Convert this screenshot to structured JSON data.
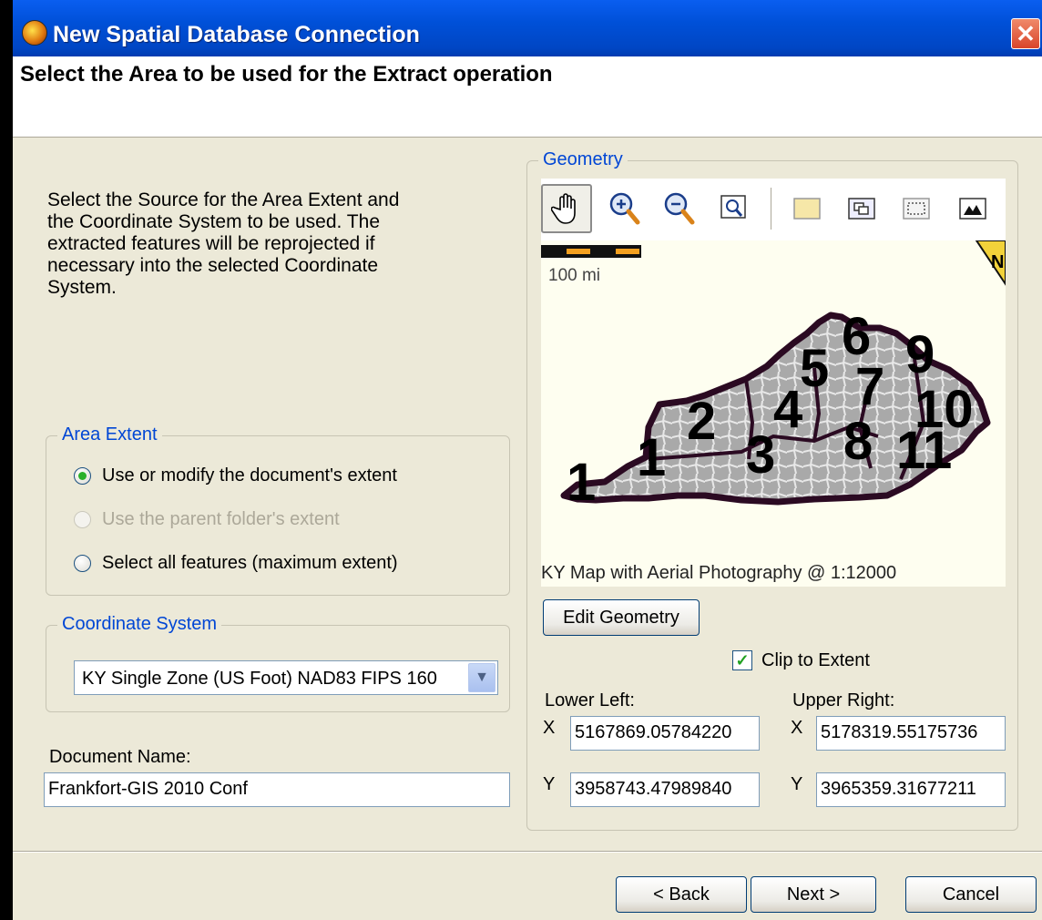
{
  "window": {
    "title": "New Spatial Database Connection",
    "close_glyph": "✕"
  },
  "header": {
    "title": "Select the Area to be used for the Extract operation"
  },
  "instructions": "Select the Source for the Area Extent and the Coordinate System to be used. The extracted features will be reprojected if necessary into the selected Coordinate System.",
  "area_extent": {
    "legend": "Area Extent",
    "options": [
      {
        "label": "Use or modify the document's extent",
        "checked": true,
        "enabled": true
      },
      {
        "label": "Use the parent folder's extent",
        "checked": false,
        "enabled": false
      },
      {
        "label": "Select all features (maximum extent)",
        "checked": false,
        "enabled": true
      }
    ]
  },
  "coordinate_system": {
    "legend": "Coordinate System",
    "selected": "KY Single Zone (US Foot) NAD83 FIPS 160"
  },
  "document_name": {
    "label": "Document Name:",
    "value": "Frankfort-GIS 2010 Conf"
  },
  "geometry": {
    "legend": "Geometry",
    "tools": [
      {
        "icon": "pan-hand-icon",
        "active": true
      },
      {
        "icon": "zoom-in-icon",
        "active": false
      },
      {
        "icon": "zoom-out-icon",
        "active": false
      },
      {
        "icon": "zoom-window-icon",
        "active": false
      },
      {
        "icon": "folder-extent-icon",
        "active": false
      },
      {
        "icon": "full-extent-icon",
        "active": false
      },
      {
        "icon": "select-rectangle-icon",
        "active": false
      },
      {
        "icon": "map-view-icon",
        "active": false
      }
    ],
    "map": {
      "scale_label": "100 mi",
      "caption": "KY Map with Aerial Photography @ 1:12000",
      "region_labels": [
        "1",
        "1",
        "2",
        "3",
        "4",
        "5",
        "6",
        "7",
        "8",
        "9",
        "10",
        "11"
      ],
      "corner_label": "N"
    },
    "edit_button": "Edit Geometry",
    "clip_to_extent": {
      "label": "Clip to Extent",
      "checked": true
    },
    "lower_left": {
      "label": "Lower Left:",
      "x_label": "X",
      "x": "5167869.05784220",
      "y_label": "Y",
      "y": "3958743.47989840"
    },
    "upper_right": {
      "label": "Upper Right:",
      "x_label": "X",
      "x": "5178319.55175736",
      "y_label": "Y",
      "y": "3965359.31677211"
    }
  },
  "footer": {
    "back": "< Back",
    "next": "Next >",
    "cancel": "Cancel"
  },
  "colors": {
    "title_bar": "#0054e3",
    "dialog_bg": "#ece9d8",
    "group_legend": "#0046d5",
    "county_fill": "#b4b4b4",
    "state_border": "#2b0a22"
  }
}
